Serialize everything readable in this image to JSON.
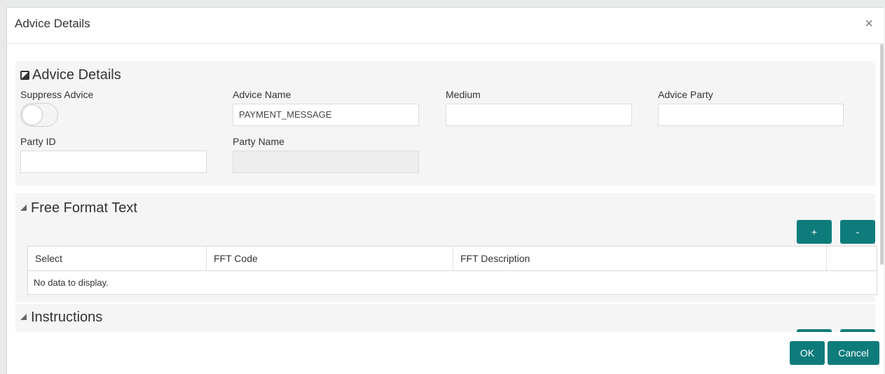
{
  "modal": {
    "title": "Advice Details",
    "close_glyph": "×"
  },
  "advice_section": {
    "title": "Advice Details",
    "fields": {
      "suppress_advice": {
        "label": "Suppress Advice",
        "value": "off"
      },
      "advice_name": {
        "label": "Advice Name",
        "value": "PAYMENT_MESSAGE"
      },
      "medium": {
        "label": "Medium",
        "value": ""
      },
      "advice_party": {
        "label": "Advice Party",
        "value": ""
      },
      "party_id": {
        "label": "Party ID",
        "value": ""
      },
      "party_name": {
        "label": "Party Name",
        "value": ""
      }
    }
  },
  "fft_section": {
    "title": "Free Format Text",
    "add_label": "+",
    "remove_label": "-",
    "columns": [
      "Select",
      "FFT Code",
      "FFT Description"
    ],
    "empty_text": "No data to display."
  },
  "instructions_section": {
    "title": "Instructions"
  },
  "footer": {
    "ok_label": "OK",
    "cancel_label": "Cancel"
  },
  "colors": {
    "accent": "#0e7c7b",
    "panel_bg": "#f5f5f5",
    "readonly_bg": "#eeeeee"
  },
  "icons": {
    "section_collapse": "triangle-collapse-icon",
    "section_checkbox": "section-checkbox-icon",
    "close": "close-icon"
  }
}
